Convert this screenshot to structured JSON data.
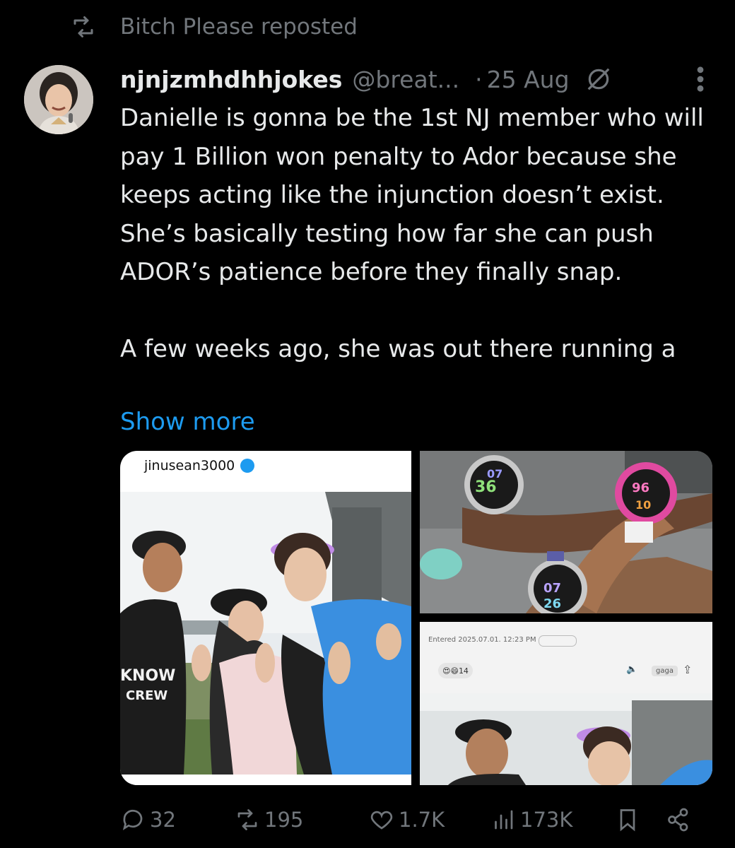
{
  "repost": {
    "label": "Bitch Please reposted"
  },
  "tweet": {
    "author_name": "njnjzmhdhhjokes",
    "author_handle": "@breat...",
    "date": "25 Aug",
    "text": "Danielle is gonna be the 1st NJ member who will pay 1 Billion won penalty to Ador because she keeps acting like the injunction doesn’t exist. She’s basically testing how far she can push ADOR’s patience before they finally snap.\n\nA few weeks ago, she was out there running a",
    "show_more": "Show more"
  },
  "media": {
    "left": {
      "username": "jinusean3000",
      "shirt_text": "KNOW CREW"
    },
    "top_right": {
      "watch_numbers": [
        "07",
        "36",
        "96",
        "10",
        "07",
        "26"
      ]
    },
    "bottom_right": {
      "entered": "Entered 2025.07.01. 12:23 PM",
      "reaction_count": "14",
      "audio_label": "gaga"
    }
  },
  "actions": {
    "replies": "32",
    "reposts": "195",
    "likes": "1.7K",
    "views": "173K"
  },
  "colors": {
    "accent": "#1d9bf0",
    "muted": "#71767b",
    "text": "#e7e9ea"
  }
}
